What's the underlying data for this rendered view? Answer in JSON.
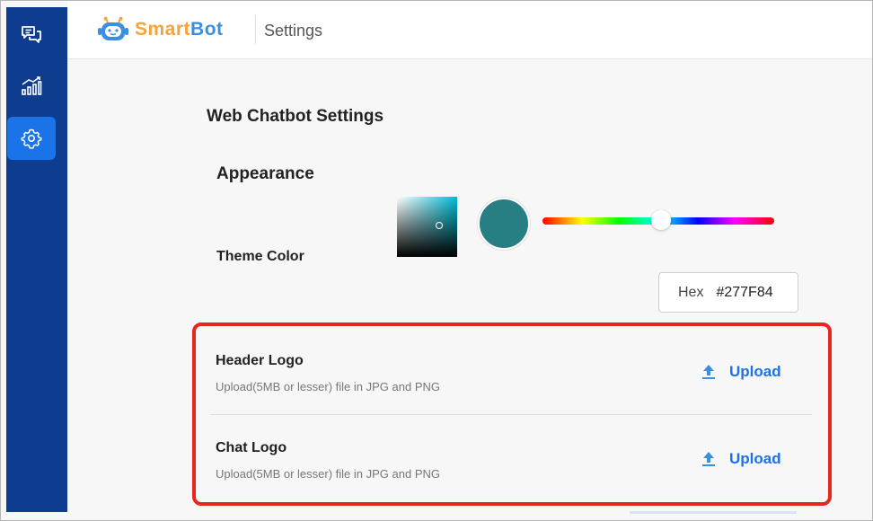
{
  "app": {
    "logo_part1": "Smart",
    "logo_part2": "Bot",
    "page": "Settings"
  },
  "sidebar": {
    "items": [
      {
        "icon": "chat-bubbles-icon",
        "active": false
      },
      {
        "icon": "analytics-icon",
        "active": false
      },
      {
        "icon": "gear-icon",
        "active": true
      }
    ]
  },
  "content": {
    "section_title": "Web Chatbot Settings",
    "appearance_title": "Appearance",
    "theme_color_label": "Theme Color",
    "hex_label": "Hex",
    "hex_value": "#277F84"
  },
  "uploads": [
    {
      "title": "Header Logo",
      "desc": "Upload(5MB or lesser) file in JPG and PNG",
      "button": "Upload"
    },
    {
      "title": "Chat Logo",
      "desc": "Upload(5MB or lesser) file in JPG and PNG",
      "button": "Upload"
    }
  ],
  "colors": {
    "sidebar_bg": "#0e3d8f",
    "active_nav": "#1b73e8",
    "accent": "#1a73e8",
    "theme": "#277F84",
    "highlight_border": "#e8251f"
  }
}
